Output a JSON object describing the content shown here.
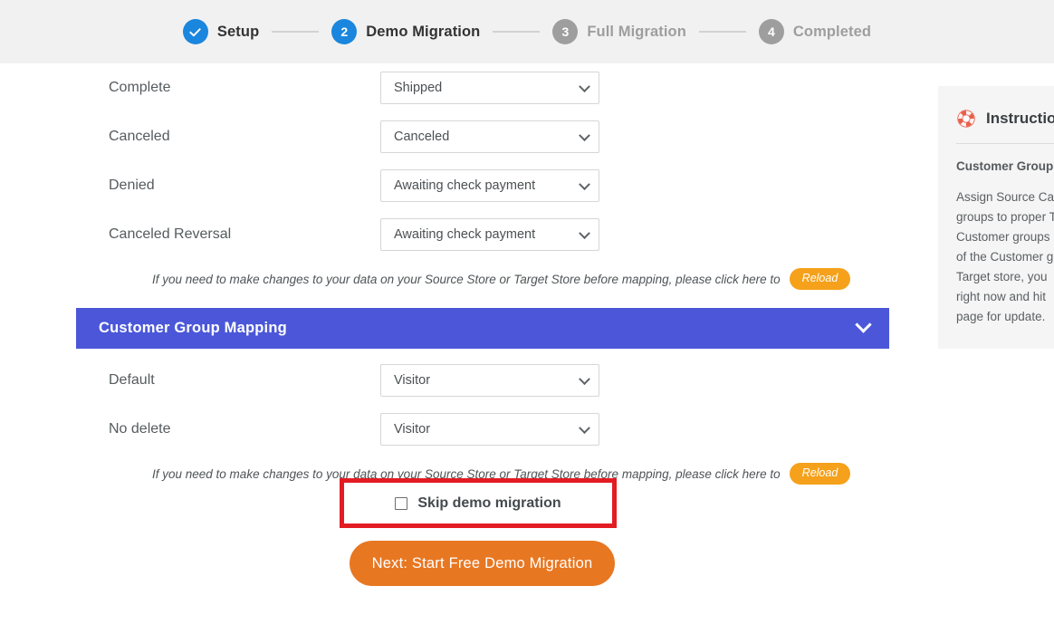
{
  "stepper": {
    "steps": [
      {
        "num": "✓",
        "label": "Setup",
        "state": "done"
      },
      {
        "num": "2",
        "label": "Demo Migration",
        "state": "active"
      },
      {
        "num": "3",
        "label": "Full Migration",
        "state": "todo"
      },
      {
        "num": "4",
        "label": "Completed",
        "state": "todo"
      }
    ]
  },
  "order_status_mapping": {
    "rows": [
      {
        "label": "Complete",
        "value": "Shipped"
      },
      {
        "label": "Canceled",
        "value": "Canceled"
      },
      {
        "label": "Denied",
        "value": "Awaiting check payment"
      },
      {
        "label": "Canceled Reversal",
        "value": "Awaiting check payment"
      }
    ]
  },
  "notice": {
    "text": "If you need to make changes to your data on your Source Store or Target Store before mapping, please click here to",
    "reload_label": "Reload"
  },
  "customer_group_section": {
    "title": "Customer Group Mapping",
    "collapse_icon": "chevron-down-icon",
    "rows": [
      {
        "label": "Default",
        "value": "Visitor"
      },
      {
        "label": "No delete",
        "value": "Visitor"
      }
    ]
  },
  "skip": {
    "label": "Skip demo migration",
    "checked": false,
    "highlight_color": "#e31c23"
  },
  "next_button": {
    "label": "Next: Start Free Demo Migration",
    "color": "#e87722"
  },
  "instructions": {
    "icon": "lifebuoy-icon",
    "title": "Instructions",
    "subtitle": "Customer Group Mapping",
    "lines": [
      "Assign Source Ca",
      "groups to proper T",
      "Customer groups",
      "of the Customer g",
      "Target store, you",
      "right now and hit",
      "page for update."
    ]
  },
  "colors": {
    "header_bg": "#f1f1f1",
    "step_active": "#1a86dd",
    "step_todo": "#9e9e9e",
    "section_bar": "#4b57d8",
    "reload_pill": "#f5a11b"
  }
}
